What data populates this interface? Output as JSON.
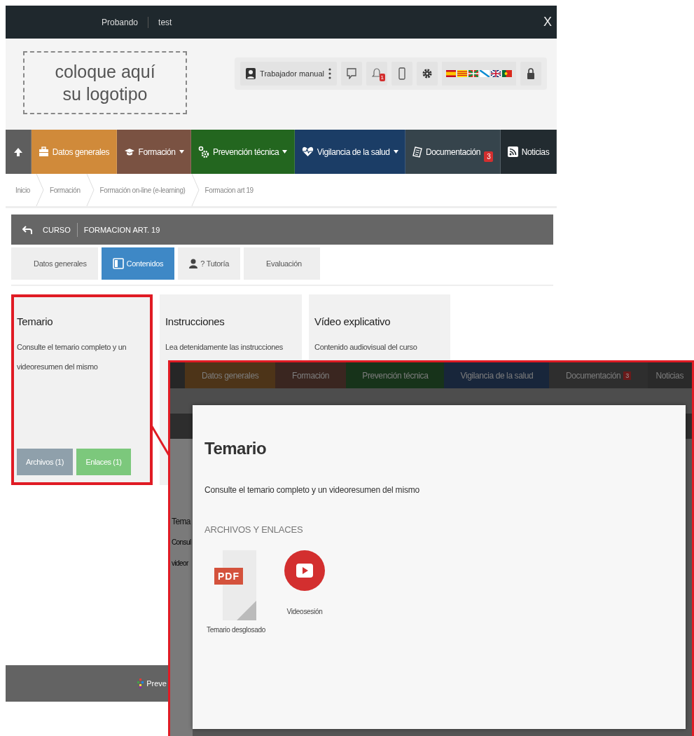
{
  "top_bar": {
    "items": [
      "Probando",
      "test"
    ],
    "close": "X"
  },
  "logo_placeholder": {
    "lines": [
      "coloque aquí",
      "su logotipo"
    ]
  },
  "user_menu": {
    "user": "Trabajador manual",
    "notification_count": "1"
  },
  "nav": [
    {
      "color": "#5e5e5e",
      "dropdown": false
    },
    {
      "label": "Datos generales",
      "color": "#d08a3a",
      "dropdown": false
    },
    {
      "label": "Formación",
      "color": "#7a5242",
      "dropdown": true
    },
    {
      "label": "Prevención técnica",
      "color": "#23661f",
      "dropdown": true
    },
    {
      "label": "Vigilancia de la salud",
      "color": "#1b3d66",
      "dropdown": true
    },
    {
      "label": "Documentación",
      "color": "#36444c",
      "dropdown": false,
      "badge": "3"
    },
    {
      "label": "Noticias",
      "color": "#222b30",
      "dropdown": false
    }
  ],
  "breadcrumb": [
    "Inicio",
    "Formación",
    "Formación on-line (e-learning)",
    "Formacion art 19"
  ],
  "course_bar": {
    "kind_label": "CURSO",
    "title": "FORMACION ART. 19"
  },
  "tabs": [
    {
      "label": "Datos generales",
      "selected": false
    },
    {
      "label": "Contenidos",
      "selected": true
    },
    {
      "label": "? Tutoría",
      "selected": false
    },
    {
      "label": "Evaluación",
      "selected": false
    }
  ],
  "cards": [
    {
      "title": "Temario",
      "description": "Consulte el temario completo y un videoresumen del mismo",
      "highlighted": true,
      "buttons": [
        {
          "label": "Archivos (1)",
          "kind": "files"
        },
        {
          "label": "Enlaces (1)",
          "kind": "links"
        }
      ]
    },
    {
      "title": "Instrucciones",
      "description": "Lea detenidamente las instrucciones",
      "highlighted": false
    },
    {
      "title": "Vídeo explicativo",
      "description": "Contenido audiovisual del curso",
      "highlighted": false
    }
  ],
  "footer": {
    "text": "Preve"
  },
  "inset": {
    "backdrop_nav": [
      "Datos generales",
      "Formación",
      "Prevención técnica",
      "Vigilancia de la salud",
      "Documentación",
      "Noticias"
    ],
    "backdrop_badge": "3",
    "backdrop_texts": [
      "Tema",
      "Consul",
      "videor"
    ],
    "modal": {
      "title": "Temario",
      "description": "Consulte el temario completo y un videoresumen del mismo",
      "section_title": "ARCHIVOS Y ENLACES",
      "items": [
        {
          "kind": "pdf",
          "badge": "PDF",
          "label": "Temario desglosado"
        },
        {
          "kind": "video",
          "label": "Videosesión"
        }
      ]
    }
  }
}
